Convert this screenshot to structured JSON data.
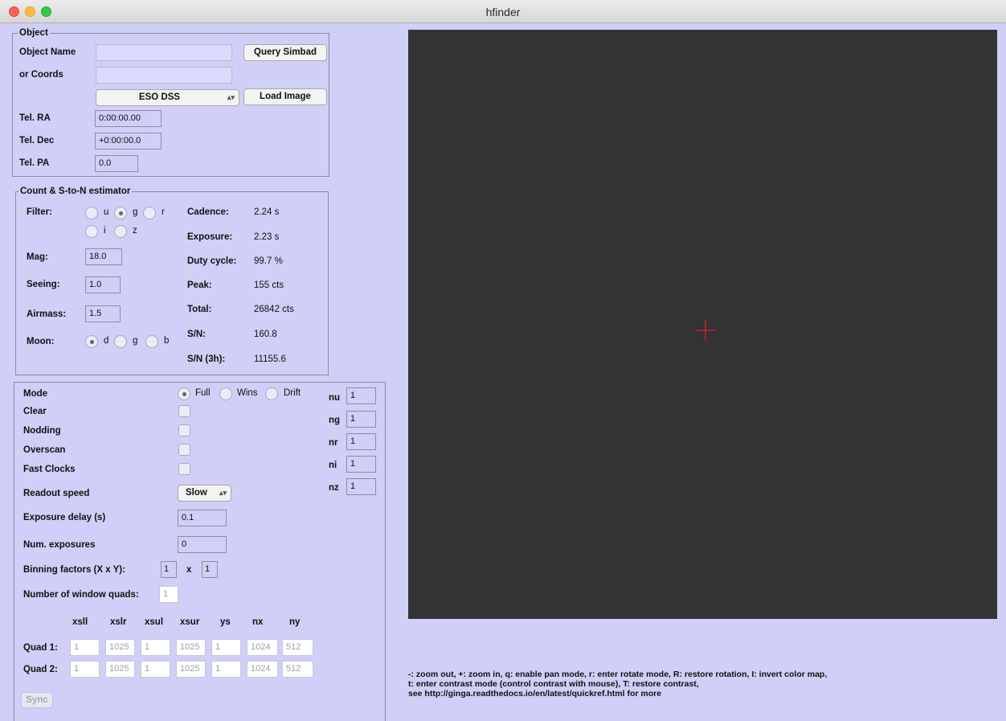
{
  "window": {
    "title": "hfinder"
  },
  "object": {
    "legend": "Object",
    "name_label": "Object Name",
    "name_value": "",
    "query_button": "Query Simbad",
    "coords_label": "or Coords",
    "coords_value": "",
    "survey_selected": "ESO DSS",
    "load_button": "Load Image",
    "tel_ra_label": "Tel. RA",
    "tel_ra_value": "0:00:00.00",
    "tel_dec_label": "Tel. Dec",
    "tel_dec_value": "+0:00:00.0",
    "tel_pa_label": "Tel. PA",
    "tel_pa_value": "0.0"
  },
  "estimator": {
    "legend": "Count & S-to-N estimator",
    "filter_label": "Filter:",
    "filters": [
      "u",
      "g",
      "r",
      "i",
      "z"
    ],
    "filter_selected": "g",
    "mag_label": "Mag:",
    "mag_value": "18.0",
    "seeing_label": "Seeing:",
    "seeing_value": "1.0",
    "airmass_label": "Airmass:",
    "airmass_value": "1.5",
    "moon_label": "Moon:",
    "moon_options": [
      "d",
      "g",
      "b"
    ],
    "moon_selected": "d",
    "cadence_label": "Cadence:",
    "cadence_value": "2.24 s",
    "exposure_label": "Exposure:",
    "exposure_value": "2.23 s",
    "duty_label": "Duty cycle:",
    "duty_value": "99.7 %",
    "peak_label": "Peak:",
    "peak_value": "155 cts",
    "total_label": "Total:",
    "total_value": "26842 cts",
    "sn_label": "S/N:",
    "sn_value": "160.8",
    "sn3h_label": "S/N (3h):",
    "sn3h_value": "11155.6"
  },
  "instrument": {
    "mode_label": "Mode",
    "modes": [
      "Full",
      "Wins",
      "Drift"
    ],
    "mode_selected": "Full",
    "clear_label": "Clear",
    "nodding_label": "Nodding",
    "overscan_label": "Overscan",
    "fast_clocks_label": "Fast Clocks",
    "readout_label": "Readout speed",
    "readout_value": "Slow",
    "exp_delay_label": "Exposure delay (s)",
    "exp_delay_value": "0.1",
    "num_exp_label": "Num. exposures",
    "num_exp_value": "0",
    "binning_label": "Binning factors (X x Y):",
    "bin_x": "1",
    "bin_sep": "x",
    "bin_y": "1",
    "nquads_label": "Number of window quads:",
    "nquads_value": "1",
    "nframes": [
      {
        "label": "nu",
        "value": "1"
      },
      {
        "label": "ng",
        "value": "1"
      },
      {
        "label": "nr",
        "value": "1"
      },
      {
        "label": "ni",
        "value": "1"
      },
      {
        "label": "nz",
        "value": "1"
      }
    ],
    "quad_headers": [
      "xsll",
      "xslr",
      "xsul",
      "xsur",
      "ys",
      "nx",
      "ny"
    ],
    "quads": [
      {
        "label": "Quad 1:",
        "values": [
          "1",
          "1025",
          "1",
          "1025",
          "1",
          "1024",
          "512"
        ]
      },
      {
        "label": "Quad 2:",
        "values": [
          "1",
          "1025",
          "1",
          "1025",
          "1",
          "1024",
          "512"
        ]
      }
    ],
    "sync_button": "Sync"
  },
  "help_lines": [
    "-: zoom out, +: zoom in, q: enable pan mode, r: enter rotate mode,  R: restore rotation, I: invert color map,",
    " t: enter contrast mode (control contrast with mouse), T: restore contrast,",
    " see http://ginga.readthedocs.io/en/latest/quickref.html for more"
  ],
  "colors": {
    "window_bg": "#cfcff7",
    "viewer_bg": "#333333",
    "cursor": "#ff2020"
  }
}
